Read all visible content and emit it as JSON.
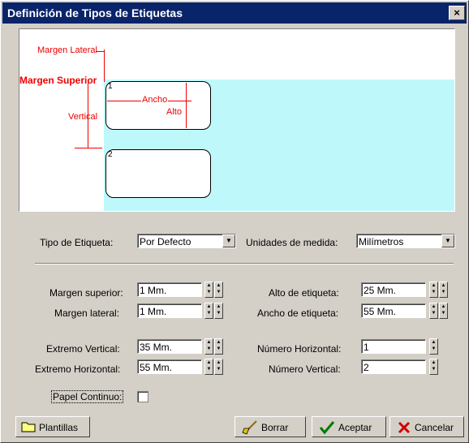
{
  "window": {
    "title": "Definición de Tipos de Etiquetas",
    "close_glyph": "×"
  },
  "preview": {
    "margen_lateral": "Margen Lateral",
    "margen_superior": "Margen Superior",
    "vertical": "Vertical",
    "ancho": "Ancho",
    "alto": "Alto",
    "label1_num": "1",
    "label2_num": "2"
  },
  "form": {
    "tipo_label": "Tipo de Etiqueta:",
    "tipo_value": "Por Defecto",
    "unidades_label": "Unidades de medida:",
    "unidades_value": "Milímetros",
    "margen_superior_label": "Margen superior:",
    "margen_superior_value": "1 Mm.",
    "margen_lateral_label": "Margen lateral:",
    "margen_lateral_value": "1 Mm.",
    "alto_label": "Alto de etiqueta:",
    "alto_value": "25 Mm.",
    "ancho_label": "Ancho de etiqueta:",
    "ancho_value": "55 Mm.",
    "extremo_vertical_label": "Extremo Vertical:",
    "extremo_vertical_value": "35 Mm.",
    "extremo_horizontal_label": "Extremo Horizontal:",
    "extremo_horizontal_value": "55 Mm.",
    "numero_horizontal_label": "Número Horizontal:",
    "numero_horizontal_value": "1",
    "numero_vertical_label": "Número Vertical:",
    "numero_vertical_value": "2",
    "papel_continuo_label": "Papel Continuo:"
  },
  "buttons": {
    "plantillas": "Plantillas",
    "borrar": "Borrar",
    "aceptar": "Aceptar",
    "cancelar": "Cancelar"
  },
  "colors": {
    "title_bar": "#0a246a",
    "preview_area": "#bff8fb",
    "annotation": "#e00000"
  }
}
